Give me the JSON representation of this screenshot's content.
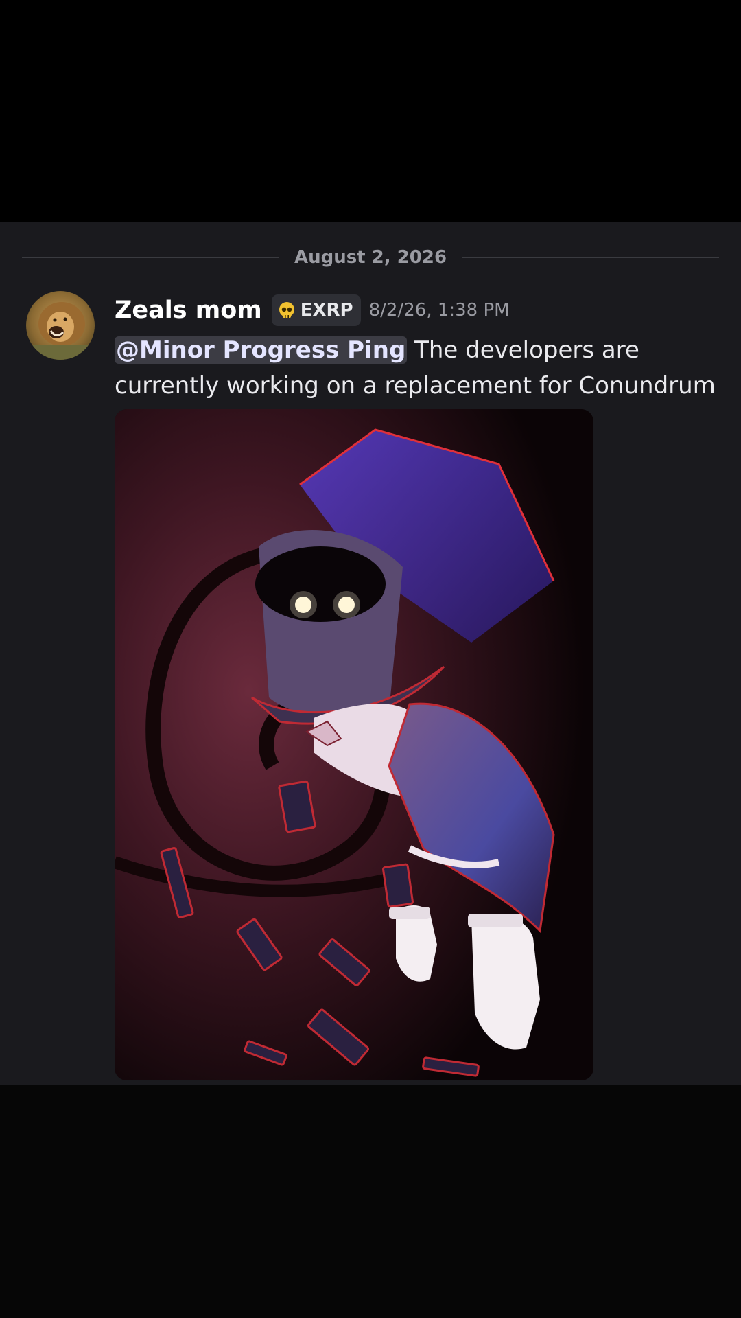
{
  "divider": {
    "date": "August 2, 2026"
  },
  "message": {
    "author": "Zeals mom",
    "tag": {
      "icon": "skull-icon",
      "label": "EXRP"
    },
    "timestamp": "8/2/26, 1:38 PM",
    "mention": "@Minor Progress Ping",
    "text": " The developers are currently working on a replacement for Conundrum",
    "avatar": "lion-avatar",
    "attachment": "magician-illustration-image"
  },
  "colors": {
    "background": "#1a1a1e",
    "divider_line": "#3a3b40",
    "muted_text": "#9a9ba2",
    "mention_bg": "#3c3c44",
    "tag_bg": "#2e2f35"
  }
}
